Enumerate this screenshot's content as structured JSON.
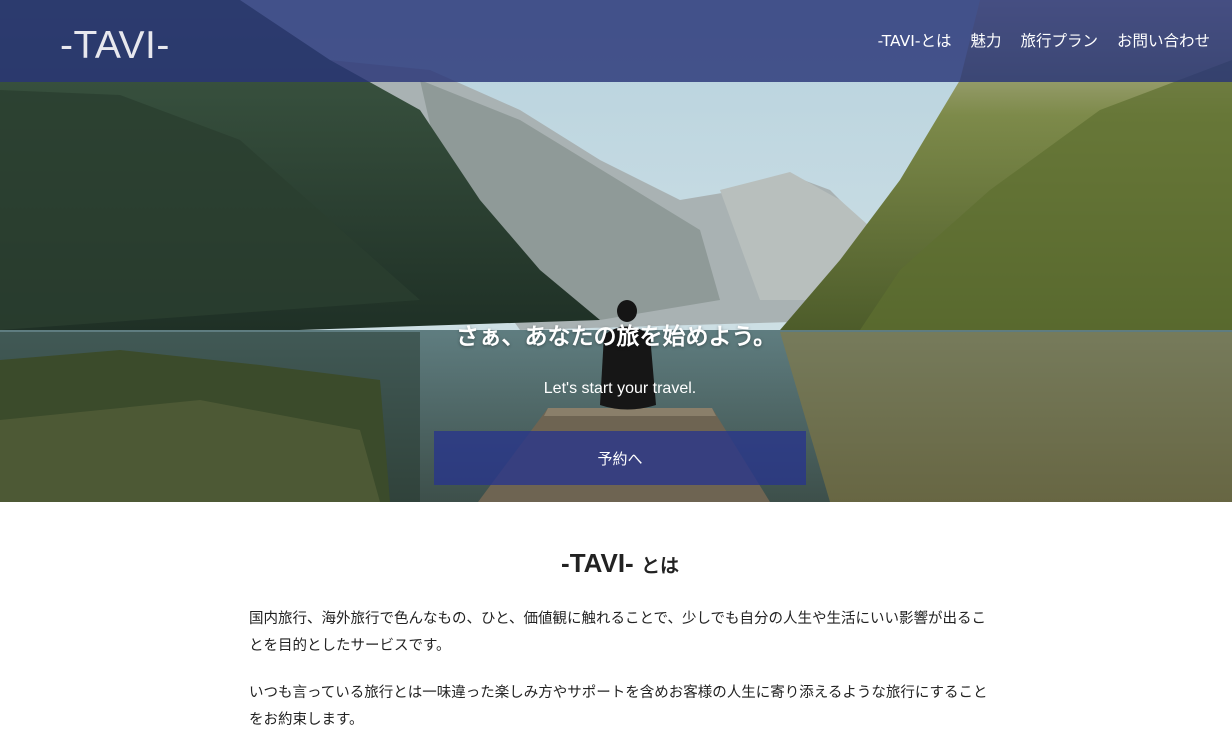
{
  "header": {
    "logo": "-TAVI-",
    "nav": [
      {
        "label": "-TAVI-とは"
      },
      {
        "label": "魅力"
      },
      {
        "label": "旅行プラン"
      },
      {
        "label": "お問い合わせ"
      }
    ]
  },
  "hero": {
    "title": "さぁ、あなたの旅を始めよう。",
    "subtitle": "Let's start your travel.",
    "cta_label": "予約へ"
  },
  "about": {
    "title_main": "-TAVI-",
    "title_suffix": "とは",
    "paragraphs": [
      "国内旅行、海外旅行で色んなもの、ひと、価値観に触れることで、少しでも自分の人生や生活にいい影響が出ることを目的としたサービスです。",
      "いつも言っている旅行とは一味違った楽しみ方やサポートを含めお客様の人生に寄り添えるような旅行にすることをお約束します。"
    ]
  },
  "colors": {
    "header_bg": "#283478",
    "cta_bg": "#28348c",
    "text": "#222222"
  }
}
